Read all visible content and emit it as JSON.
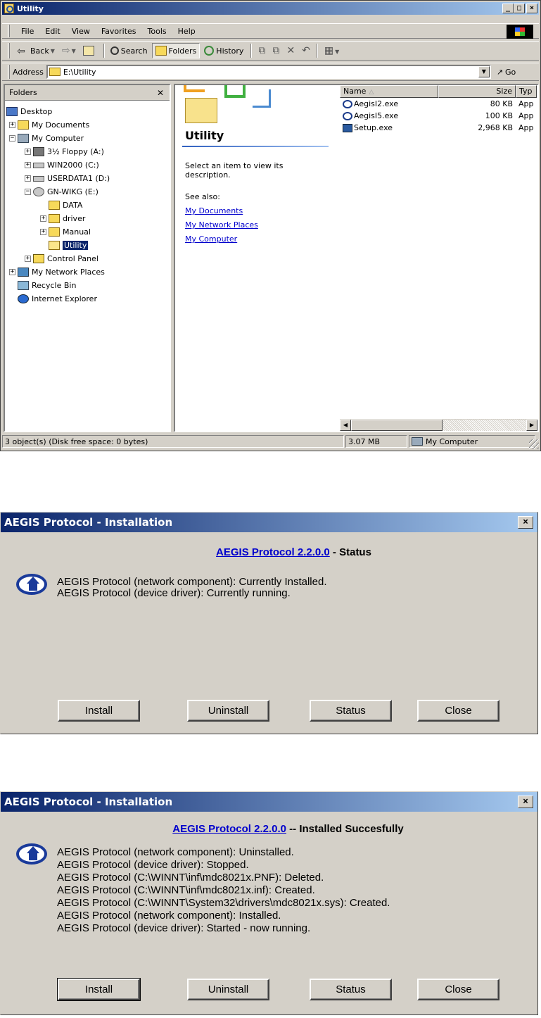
{
  "explorer": {
    "title": "Utility",
    "menu": [
      "File",
      "Edit",
      "View",
      "Favorites",
      "Tools",
      "Help"
    ],
    "toolbar": {
      "back": "Back",
      "search": "Search",
      "folders": "Folders",
      "history": "History"
    },
    "address": {
      "label": "Address",
      "value": "E:\\Utility",
      "go": "Go"
    },
    "folders_pane": {
      "header": "Folders",
      "tree": [
        {
          "label": "Desktop",
          "icon": "desktop-icon",
          "level": 0
        },
        {
          "label": "My Documents",
          "icon": "my-documents-icon",
          "level": 1
        },
        {
          "label": "My Computer",
          "icon": "my-computer-icon",
          "level": 1
        },
        {
          "label": "3½ Floppy (A:)",
          "icon": "floppy-icon",
          "level": 2
        },
        {
          "label": "WIN2000 (C:)",
          "icon": "drive-icon",
          "level": 2
        },
        {
          "label": "USERDATA1 (D:)",
          "icon": "drive-icon",
          "level": 2
        },
        {
          "label": "GN-WIKG (E:)",
          "icon": "cd-drive-icon",
          "level": 2
        },
        {
          "label": "DATA",
          "icon": "folder-icon",
          "level": 3
        },
        {
          "label": "driver",
          "icon": "folder-icon",
          "level": 3
        },
        {
          "label": "Manual",
          "icon": "folder-icon",
          "level": 3
        },
        {
          "label": "Utility",
          "icon": "open-folder-icon",
          "level": 3
        },
        {
          "label": "Control Panel",
          "icon": "control-panel-icon",
          "level": 2
        },
        {
          "label": "My Network Places",
          "icon": "network-places-icon",
          "level": 1
        },
        {
          "label": "Recycle Bin",
          "icon": "recycle-bin-icon",
          "level": 1
        },
        {
          "label": "Internet Explorer",
          "icon": "internet-explorer-icon",
          "level": 1
        }
      ]
    },
    "webview": {
      "title": "Utility",
      "description": "Select an item to view its description.",
      "see_also": "See also:",
      "links": [
        "My Documents",
        "My Network Places",
        "My Computer"
      ]
    },
    "file_list": {
      "columns": [
        "Name",
        "Size",
        "Typ"
      ],
      "rows": [
        {
          "name": "AegisI2.exe",
          "size": "80 KB",
          "type": "App",
          "icon": "aegis-exe-icon"
        },
        {
          "name": "AegisI5.exe",
          "size": "100 KB",
          "type": "App",
          "icon": "aegis-exe-icon"
        },
        {
          "name": "Setup.exe",
          "size": "2,968 KB",
          "type": "App",
          "icon": "setup-exe-icon"
        }
      ]
    },
    "statusbar": {
      "objects": "3 object(s) (Disk free space: 0 bytes)",
      "size": "3.07 MB",
      "zone": "My Computer"
    }
  },
  "dialog_status": {
    "title": "AEGIS Protocol - Installation",
    "heading_link": "AEGIS Protocol 2.2.0.0",
    "heading_rest": " - Status",
    "lines": [
      "AEGIS Protocol (network component):  Currently Installed.",
      "AEGIS Protocol (device driver):  Currently running."
    ],
    "buttons": [
      "Install",
      "Uninstall",
      "Status",
      "Close"
    ]
  },
  "dialog_installed": {
    "title": "AEGIS Protocol - Installation",
    "heading_link": "AEGIS Protocol 2.2.0.0",
    "heading_rest": " -- Installed Succesfully",
    "lines": [
      "AEGIS Protocol (network component):  Uninstalled.",
      "AEGIS Protocol (device driver):  Stopped.",
      "AEGIS Protocol (C:\\WINNT\\inf\\mdc8021x.PNF):  Deleted.",
      "AEGIS Protocol (C:\\WINNT\\inf\\mdc8021x.inf):  Created.",
      "AEGIS Protocol (C:\\WINNT\\System32\\drivers\\mdc8021x.sys):  Created.",
      "AEGIS Protocol (network component):  Installed.",
      "AEGIS Protocol (device driver):  Started - now running."
    ],
    "buttons": [
      "Install",
      "Uninstall",
      "Status",
      "Close"
    ]
  }
}
